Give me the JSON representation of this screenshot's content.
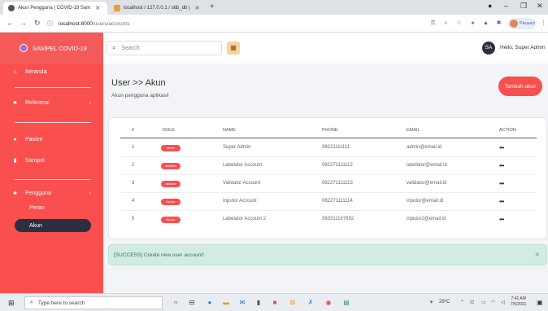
{
  "browser": {
    "tabs": [
      {
        "title": "Akun Pengguna | COVID-19 Sam"
      },
      {
        "title": "localhost / 127.0.0.1 / sttb_db |"
      }
    ],
    "new_tab": "+",
    "url_host": "localhost:8000",
    "url_path": "/users/accounts",
    "profile_status": "Paused"
  },
  "sidebar": {
    "brand": "SAMPEL COVID-19",
    "items": [
      {
        "label": "Beranda"
      },
      {
        "label": "Referensi"
      },
      {
        "label": "Pasien"
      },
      {
        "label": "Sampel"
      },
      {
        "label": "Pengguna"
      }
    ],
    "subitems": [
      {
        "label": "Peran"
      },
      {
        "label": "Akun"
      }
    ]
  },
  "topbar": {
    "search_placeholder": "Search",
    "avatar_initials": "SA",
    "greeting": "Hello, Super Admin"
  },
  "page": {
    "title": "User >> Akun",
    "subtitle": "Akun pengguna aplikasi!",
    "add_button": "Tambah akun"
  },
  "table": {
    "headers": [
      "#",
      "ROLE",
      "NAME",
      "PHONE",
      "EMAIL",
      "ACTION"
    ],
    "rows": [
      {
        "no": "1",
        "role": "admin",
        "name": "Super Admin",
        "phone": "08221111111",
        "email": "admin@email.id",
        "action": "•••"
      },
      {
        "no": "2",
        "role": "labelator",
        "name": "Labelator Account",
        "phone": "082271111112",
        "email": "labelator@email.id",
        "action": "•••"
      },
      {
        "no": "3",
        "role": "validator",
        "name": "Validator Account",
        "phone": "082271111113",
        "email": "validator@email.id",
        "action": "•••"
      },
      {
        "no": "4",
        "role": "inputor",
        "name": "Inputor Account",
        "phone": "082271111114",
        "email": "inputor@email.id",
        "action": "•••"
      },
      {
        "no": "5",
        "role": "inputor",
        "name": "Labelator Account 2",
        "phone": "083311167692",
        "email": "inputor2@email.id",
        "action": "•••"
      }
    ]
  },
  "alert": {
    "message": "[SUCCESS] Create new user account!",
    "close": "×"
  },
  "taskbar": {
    "search_placeholder": "Type here to search",
    "weather": "29°C",
    "time": "7:41 AM",
    "date": "7/5/2021"
  },
  "colors": {
    "primary_red": "#f94f4f",
    "sidebar_active": "#2c2f41",
    "alert_bg": "#d2ebe3"
  }
}
